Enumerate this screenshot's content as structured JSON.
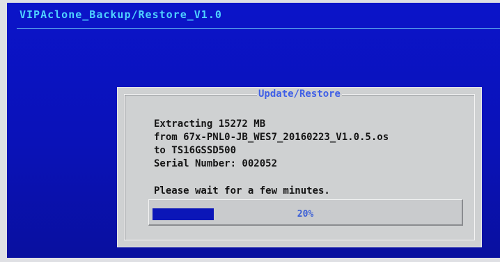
{
  "app": {
    "title": "VIPAclone_Backup/Restore_V1.0"
  },
  "dialog": {
    "title": "Update/Restore",
    "lines": [
      "Extracting 15272 MB",
      "from 67x-PNL0-JB_WES7_20160223_V1.0.5.os",
      "to TS16GSSD500",
      "Serial Number: 002052"
    ],
    "wait_message": "Please wait for a few minutes.",
    "progress": {
      "percent": 20,
      "label": "20%"
    }
  },
  "colors": {
    "screen_background": "#0a12b8",
    "title_text": "#4fd2ff",
    "dialog_background": "#cfd1d2",
    "dialog_title": "#3f5fe6",
    "progress_fill": "#0b16b8",
    "progress_text": "#3b5fd6"
  }
}
